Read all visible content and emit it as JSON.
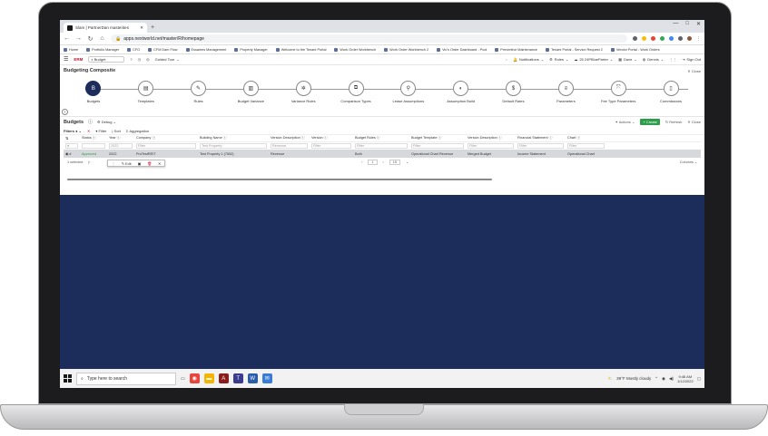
{
  "browser": {
    "tab_title": "Slam | PartnerDan masterites",
    "new_tab": "+",
    "url": "apps.nextworld.net/master/R/homepage",
    "window_controls": [
      "—",
      "□",
      "✕"
    ]
  },
  "bookmarks": [
    "Home",
    "Portfolio Manager",
    "CFO",
    "CFM Dam Flow",
    "Essames Management",
    "Property Manager",
    "Welcome to the Tenant Portal",
    "Work Order Workbench",
    "Work Order Workbench 2",
    "Vic's Order Dashboard - Pool",
    "Preventive Maintenance",
    "Tenant Portal - Service Request 2",
    "Vendor Portal - Work Orders"
  ],
  "app_header": {
    "logo": "ERM",
    "search_label": "Budget",
    "guided_tour": "Guided Tour",
    "notifications": "Notifications",
    "roles": "Roles",
    "partner": "25 24PBlueParter",
    "zone": "Dave",
    "sign_out": "Sign Out"
  },
  "composite": {
    "title": "Budgeting Composite",
    "close": "Close",
    "steps": [
      {
        "label": "Budgets",
        "icon": "B",
        "active": true
      },
      {
        "label": "Templates",
        "icon": "▤",
        "active": false
      },
      {
        "label": "Rules",
        "icon": "✎",
        "active": false
      },
      {
        "label": "Budget Variance",
        "icon": "▥",
        "active": false
      },
      {
        "label": "Variance Rules",
        "icon": "✲",
        "active": false
      },
      {
        "label": "Comparison Types",
        "icon": "⧉",
        "active": false
      },
      {
        "label": "Lease Assumptions",
        "icon": "⚲",
        "active": false
      },
      {
        "label": "Assumption Build",
        "icon": "◐",
        "active": false
      },
      {
        "label": "Default Rates",
        "icon": "$",
        "active": false
      },
      {
        "label": "Parameters",
        "icon": "≡",
        "active": false
      },
      {
        "label": "Fee Type Parameters",
        "icon": "⤧",
        "active": false
      },
      {
        "label": "Commissions",
        "icon": "▯",
        "active": false
      }
    ],
    "collapse": "›"
  },
  "budgets": {
    "title": "Budgets",
    "debug": "Debug",
    "actions": "Actions",
    "create": "+ Create",
    "refresh": "Refresh",
    "close": "Close",
    "toolbar": {
      "filters": "Filters",
      "filter": "Filter",
      "sort": "Sort",
      "aggregation": "Aggregation"
    },
    "columns": [
      "Status",
      "Year",
      "Company",
      "Building Name",
      "Version Description",
      "Version",
      "Budget Rules",
      "Budget Template",
      "Version Description",
      "Financial Statement",
      "Chart"
    ],
    "filters": [
      "",
      "2022",
      "Filter",
      "Test Property",
      "Revenue",
      "Filter",
      "Filter",
      "Filter",
      "Filter",
      "Filter",
      "Filter"
    ],
    "row": [
      "Approved",
      "2022",
      "ProTestREIT",
      "Test Property 1 (7652)",
      "Revenue",
      "",
      "Both",
      "Operational Chart Revenue",
      "Merged Budget",
      "Income Statement",
      "Operational Chart"
    ],
    "row_index": "#",
    "row_menu": {
      "edit": "Edit"
    },
    "pager": {
      "selected": "1 selected",
      "page": "1",
      "per_page": "15",
      "columns": "Columns"
    }
  },
  "taskbar": {
    "search_placeholder": "Type here to search",
    "weather": "39°F  Mostly cloudy",
    "time": "9:46 AM",
    "date": "1/12/2022"
  }
}
